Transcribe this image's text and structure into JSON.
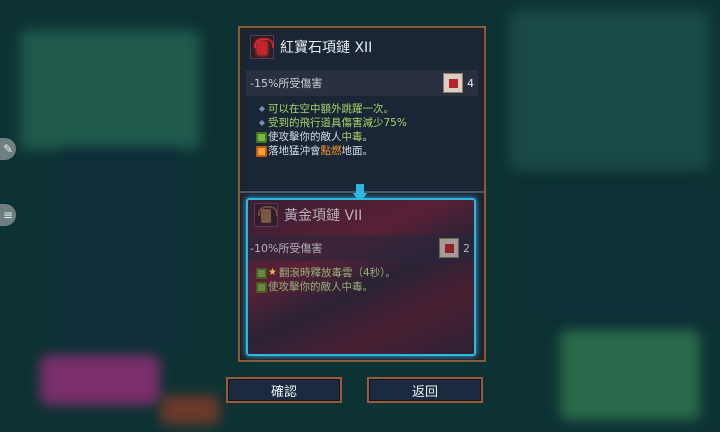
{
  "current_item": {
    "name": "紅寶石項鏈 XII",
    "icon": "ruby-necklace-icon",
    "stat": "-15%所受傷害",
    "scroll_icon": "scroll-icon",
    "scroll_count": "4",
    "effects": [
      {
        "text": "可以在空中額外跳躍一次。"
      },
      {
        "text": "受到的飛行道具傷害減少75%"
      }
    ],
    "poison_effect": {
      "pre": "使攻擊你的敵人",
      "hl": "中毒",
      "post": "。"
    },
    "fire_effect": {
      "pre": "落地猛沖會",
      "hl": "點燃",
      "post": "地面。"
    }
  },
  "compare_item": {
    "name": "黃金項鏈 VII",
    "icon": "gold-necklace-icon",
    "stat": "-10%所受傷害",
    "scroll_count": "2",
    "effects": [
      {
        "text": "翻滾時釋放毒雲（4秒）。"
      },
      {
        "text": "使攻擊你的敵人中毒。"
      }
    ]
  },
  "buttons": {
    "confirm": "確認",
    "back": "返回"
  },
  "side_icons": [
    "pencil-icon",
    "menu-icon"
  ],
  "colors": {
    "panel_border": "#8a5a3a",
    "highlight": "#2fb6e0",
    "poison_text": "#a9d46a",
    "fire_text": "#ff9b2a"
  }
}
